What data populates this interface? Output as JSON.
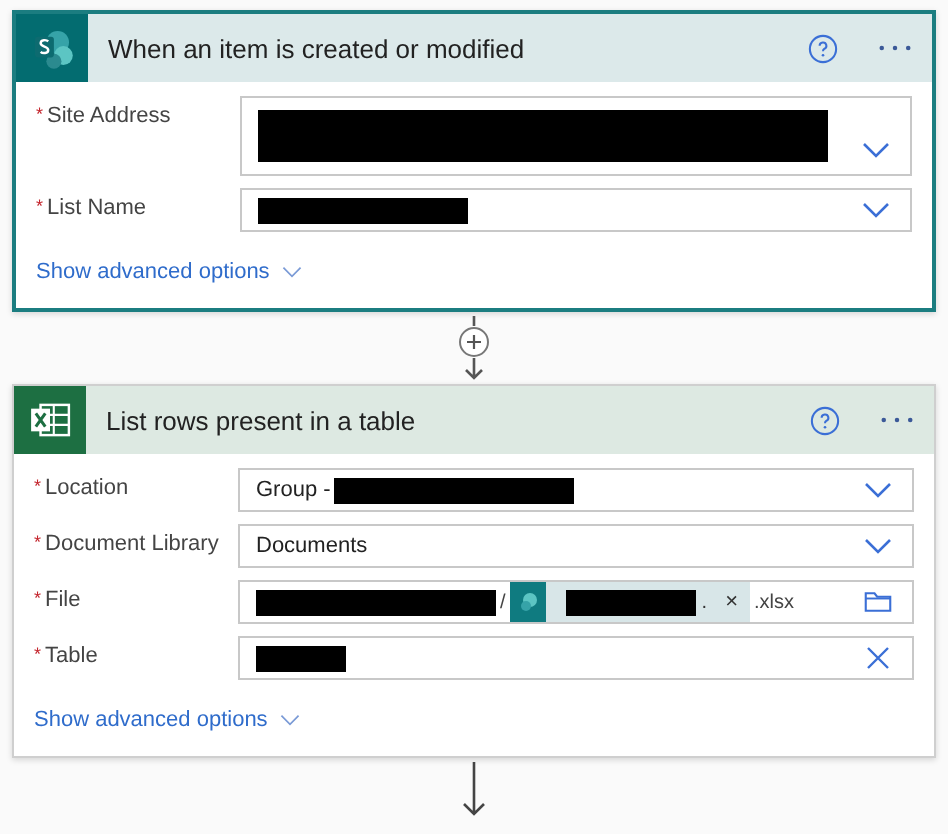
{
  "cards": [
    {
      "kind": "sharepoint",
      "selected": true,
      "title": "When an item is created or modified",
      "fields": [
        {
          "required_mark": "*",
          "label": "Site Address",
          "tall": true,
          "trailing": {
            "kind": "chevron"
          },
          "parts": [
            {
              "kind": "redaction"
            }
          ]
        },
        {
          "required_mark": "*",
          "label": "List Name",
          "tall": false,
          "trailing": {
            "kind": "chevron"
          },
          "parts": [
            {
              "kind": "redaction"
            }
          ]
        }
      ],
      "advanced": "Show advanced options"
    },
    {
      "kind": "excel",
      "selected": false,
      "title": "List rows present in a table",
      "fields": [
        {
          "required_mark": "*",
          "label": "Location",
          "tall": false,
          "trailing": {
            "kind": "chevron"
          },
          "parts": [
            {
              "kind": "text",
              "text": "Group -"
            },
            {
              "kind": "redaction"
            }
          ]
        },
        {
          "required_mark": "*",
          "label": "Document Library",
          "tall": false,
          "trailing": {
            "kind": "chevron"
          },
          "parts": [
            {
              "kind": "text",
              "text": "Documents"
            }
          ]
        },
        {
          "required_mark": "*",
          "label": "File",
          "tall": false,
          "trailing": {
            "kind": "folder"
          },
          "parts": [
            {
              "kind": "redaction"
            },
            {
              "kind": "text",
              "text": "/"
            },
            {
              "kind": "token",
              "text": ".",
              "remove": "×"
            },
            {
              "kind": "text",
              "text": ".xlsx"
            }
          ]
        },
        {
          "required_mark": "*",
          "label": "Table",
          "tall": false,
          "trailing": {
            "kind": "clear"
          },
          "parts": [
            {
              "kind": "redaction"
            }
          ]
        }
      ],
      "advanced": "Show advanced options"
    }
  ],
  "connectors": [
    {
      "kind": "insert"
    },
    {
      "kind": "arrow"
    }
  ]
}
